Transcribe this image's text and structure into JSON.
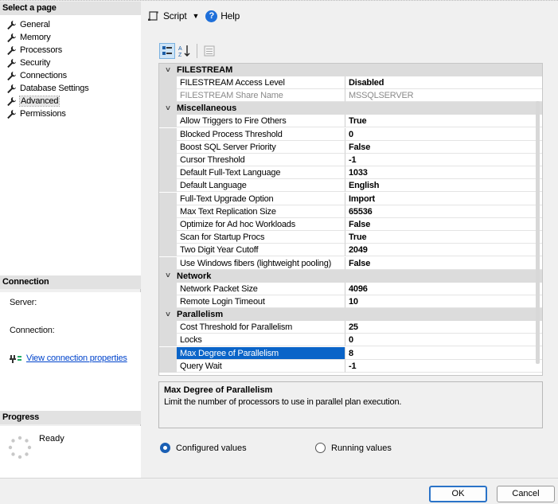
{
  "left": {
    "select_page_title": "Select a page",
    "pages": [
      "General",
      "Memory",
      "Processors",
      "Security",
      "Connections",
      "Database Settings",
      "Advanced",
      "Permissions"
    ],
    "selected_page": "Advanced",
    "connection_title": "Connection",
    "server_label": "Server:",
    "connection_label": "Connection:",
    "view_link": "View connection properties",
    "progress_title": "Progress",
    "progress_status": "Ready"
  },
  "toolbar": {
    "script_label": "Script",
    "help_label": "Help"
  },
  "grid": {
    "categories": [
      {
        "name": "FILESTREAM",
        "rows": [
          {
            "name": "FILESTREAM Access Level",
            "value": "Disabled"
          },
          {
            "name": "FILESTREAM Share Name",
            "value": "MSSQLSERVER",
            "readonly": true
          }
        ]
      },
      {
        "name": "Miscellaneous",
        "rows": [
          {
            "name": "Allow Triggers to Fire Others",
            "value": "True"
          },
          {
            "name": "Blocked Process Threshold",
            "value": "0"
          },
          {
            "name": "Boost SQL Server Priority",
            "value": "False"
          },
          {
            "name": "Cursor Threshold",
            "value": "-1"
          },
          {
            "name": "Default Full-Text Language",
            "value": "1033"
          },
          {
            "name": "Default Language",
            "value": "English"
          },
          {
            "name": "Full-Text Upgrade Option",
            "value": "Import"
          },
          {
            "name": "Max Text Replication Size",
            "value": "65536"
          },
          {
            "name": "Optimize for Ad hoc Workloads",
            "value": "False"
          },
          {
            "name": "Scan for Startup Procs",
            "value": "True"
          },
          {
            "name": "Two Digit Year Cutoff",
            "value": "2049"
          },
          {
            "name": "Use Windows fibers (lightweight pooling)",
            "value": "False"
          }
        ]
      },
      {
        "name": "Network",
        "rows": [
          {
            "name": "Network Packet Size",
            "value": "4096"
          },
          {
            "name": "Remote Login Timeout",
            "value": "10"
          }
        ]
      },
      {
        "name": "Parallelism",
        "rows": [
          {
            "name": "Cost Threshold for Parallelism",
            "value": "25"
          },
          {
            "name": "Locks",
            "value": "0"
          },
          {
            "name": "Max Degree of Parallelism",
            "value": "8",
            "selected": true
          },
          {
            "name": "Query Wait",
            "value": "-1"
          }
        ]
      }
    ]
  },
  "description": {
    "title": "Max Degree of Parallelism",
    "text": "Limit the number of processors to use in parallel plan execution."
  },
  "radios": {
    "configured": "Configured values",
    "running": "Running values"
  },
  "buttons": {
    "ok": "OK",
    "cancel": "Cancel"
  }
}
